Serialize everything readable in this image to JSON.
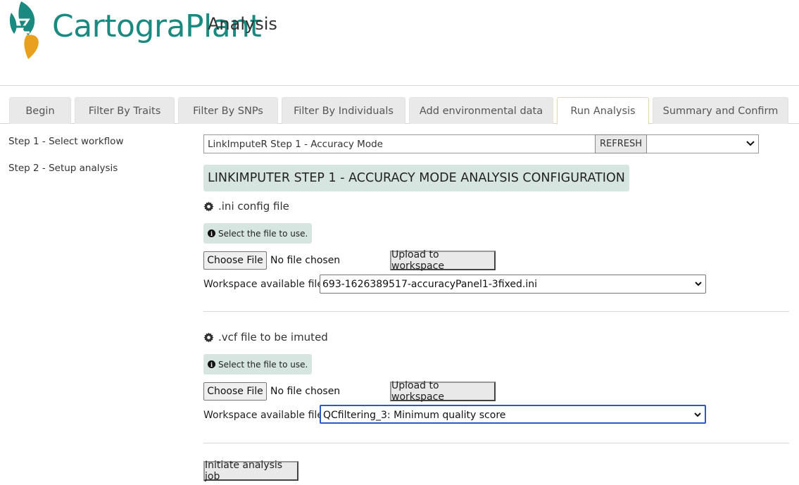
{
  "brand": {
    "name_part1": "Cartogra",
    "name_part2": "Plant",
    "subtitle": "Analysis",
    "colors": {
      "teal": "#1a8a80",
      "orange": "#e8a01e"
    }
  },
  "tabs": [
    {
      "label": "Begin",
      "active": false
    },
    {
      "label": "Filter By Traits",
      "active": false
    },
    {
      "label": "Filter By SNPs",
      "active": false
    },
    {
      "label": "Filter By Individuals",
      "active": false
    },
    {
      "label": "Add environmental data",
      "active": false
    },
    {
      "label": "Run Analysis",
      "active": true
    },
    {
      "label": "Summary and Confirm",
      "active": false
    }
  ],
  "sidebar": {
    "items": [
      {
        "label": "Step 1 - Select workflow"
      },
      {
        "label": "Step 2 - Setup analysis"
      }
    ]
  },
  "workflow": {
    "selected": "LinkImputeR Step 1 - Accuracy Mode",
    "refresh_label": "REFRESH",
    "icon": "chevron-down-icon"
  },
  "config": {
    "title": "LINKIMPUTER STEP 1 - ACCURACY MODE ANALYSIS CONFIGURATION"
  },
  "sections": [
    {
      "heading": ".ini config file",
      "icon": "gear-icon",
      "hint": "Select the file to use.",
      "choose_label": "Choose File",
      "no_file_text": "No file chosen",
      "upload_label": "Upload to workspace",
      "ws_label": "Workspace available files:",
      "ws_value": "693-1626389517-accuracyPanel1-3fixed.ini",
      "ws_focused": false
    },
    {
      "heading": ".vcf file to be imuted",
      "icon": "gear-icon",
      "hint": "Select the file to use.",
      "choose_label": "Choose File",
      "no_file_text": "No file chosen",
      "upload_label": "Upload to workspace",
      "ws_label": "Workspace available files:",
      "ws_value": "QCfiltering_3: Minimum quality score",
      "ws_focused": true
    }
  ],
  "actions": {
    "initiate_label": "Initiate analysis job"
  }
}
